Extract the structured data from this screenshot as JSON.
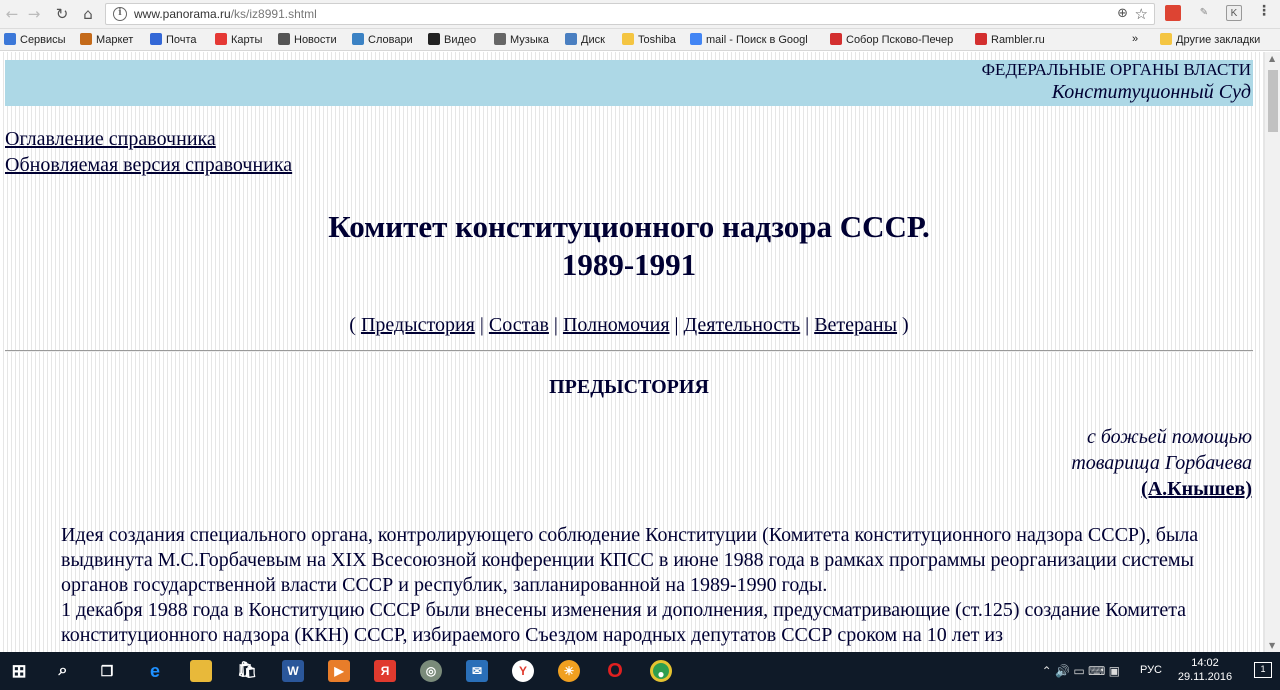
{
  "browser": {
    "url_host": "www.panorama.ru",
    "url_path": "/ks/iz8991.shtml",
    "bookmarks": [
      {
        "label": "Сервисы",
        "color": "#3c78d8"
      },
      {
        "label": "Маркет",
        "color": "#c46a1a"
      },
      {
        "label": "Почта",
        "color": "#3367d6"
      },
      {
        "label": "Карты",
        "color": "#e53935"
      },
      {
        "label": "Новости",
        "color": "#555555"
      },
      {
        "label": "Словари",
        "color": "#3b82c4"
      },
      {
        "label": "Видео",
        "color": "#222222"
      },
      {
        "label": "Музыка",
        "color": "#666666"
      },
      {
        "label": "Диск",
        "color": "#4a7fc1"
      },
      {
        "label": "Toshiba",
        "color": "#f4c542"
      },
      {
        "label": "mail - Поиск в Googl",
        "color": "#4285f4"
      },
      {
        "label": "Собор Псково-Печер",
        "color": "#d32f2f"
      },
      {
        "label": "Rambler.ru",
        "color": "#d32f2f"
      }
    ],
    "overflow": "»",
    "other_bookmarks": "Другие закладки"
  },
  "page": {
    "banner_line1": "ФЕДЕРАЛЬНЫЕ ОРГАНЫ ВЛАСТИ",
    "banner_line2": "Конституционный Суд",
    "toc_link": "Оглавление справочника",
    "updated_link": "Обновляемая версия справочника",
    "title_line1": "Комитет конституционного надзора СССР.",
    "title_line2": "1989-1991",
    "nav": {
      "open": "( ",
      "close": " )",
      "sep": " | ",
      "items": [
        "Предыстория",
        "Состав",
        "Полномочия",
        "Деятельность",
        "Ветераны"
      ]
    },
    "section_heading": "ПРЕДЫСТОРИЯ",
    "epigraph_line1": "с божьей помощью",
    "epigraph_line2": "товарища Горбачева",
    "epigraph_author": "(А.Кнышев)",
    "paragraph1": "Идея создания специального органа, контролирующего соблюдение Конституции (Комитета конституционного надзора СССР), была выдвинута М.С.Горбачевым на XIX Всесоюзной конференции КПСС в июне 1988 года в рамках программы реорганизации системы органов государственной власти СССР и республик, запланированной на 1989-1990 годы.",
    "paragraph2": "1 декабря 1988 года в Конституцию СССР были внесены изменения и дополнения, предусматривающие (ст.125) создание Комитета конституционного надзора (ККН) СССР, избираемого Съездом народных депутатов СССР сроком на 10 лет из"
  },
  "taskbar": {
    "lang": "РУС",
    "time": "14:02",
    "date": "29.11.2016",
    "notifications": "1"
  }
}
